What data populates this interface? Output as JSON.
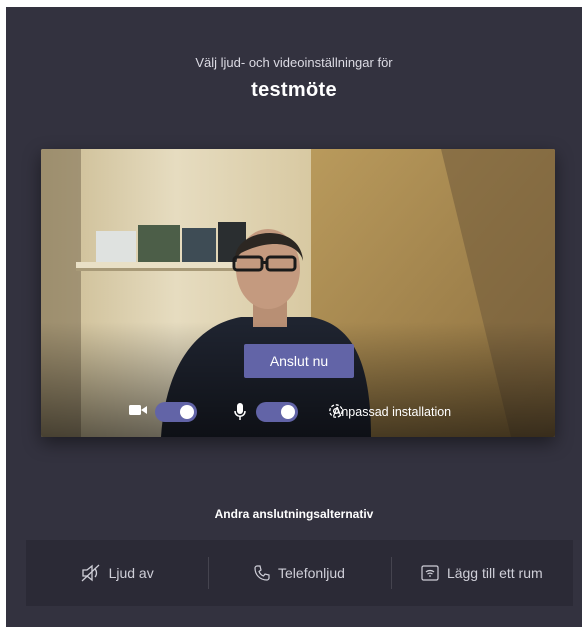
{
  "header": {
    "subtitle": "Välj ljud- och videoinställningar för",
    "meeting_title": "testmöte"
  },
  "preview": {
    "join_label": "Anslut nu",
    "camera": {
      "icon": "video-camera-icon",
      "on": true
    },
    "microphone": {
      "icon": "microphone-icon",
      "on": true
    },
    "custom_setup_label": "Anpassad installation",
    "custom_setup_icon": "gear-icon"
  },
  "other_options": {
    "heading": "Andra anslutningsalternativ",
    "items": [
      {
        "label": "Ljud av",
        "icon": "speaker-off-icon"
      },
      {
        "label": "Telefonljud",
        "icon": "phone-icon"
      },
      {
        "label": "Lägg till ett rum",
        "icon": "room-cast-icon"
      }
    ]
  },
  "colors": {
    "background": "#33323f",
    "accent": "#6264a7",
    "options_bar": "#2b2a36"
  }
}
